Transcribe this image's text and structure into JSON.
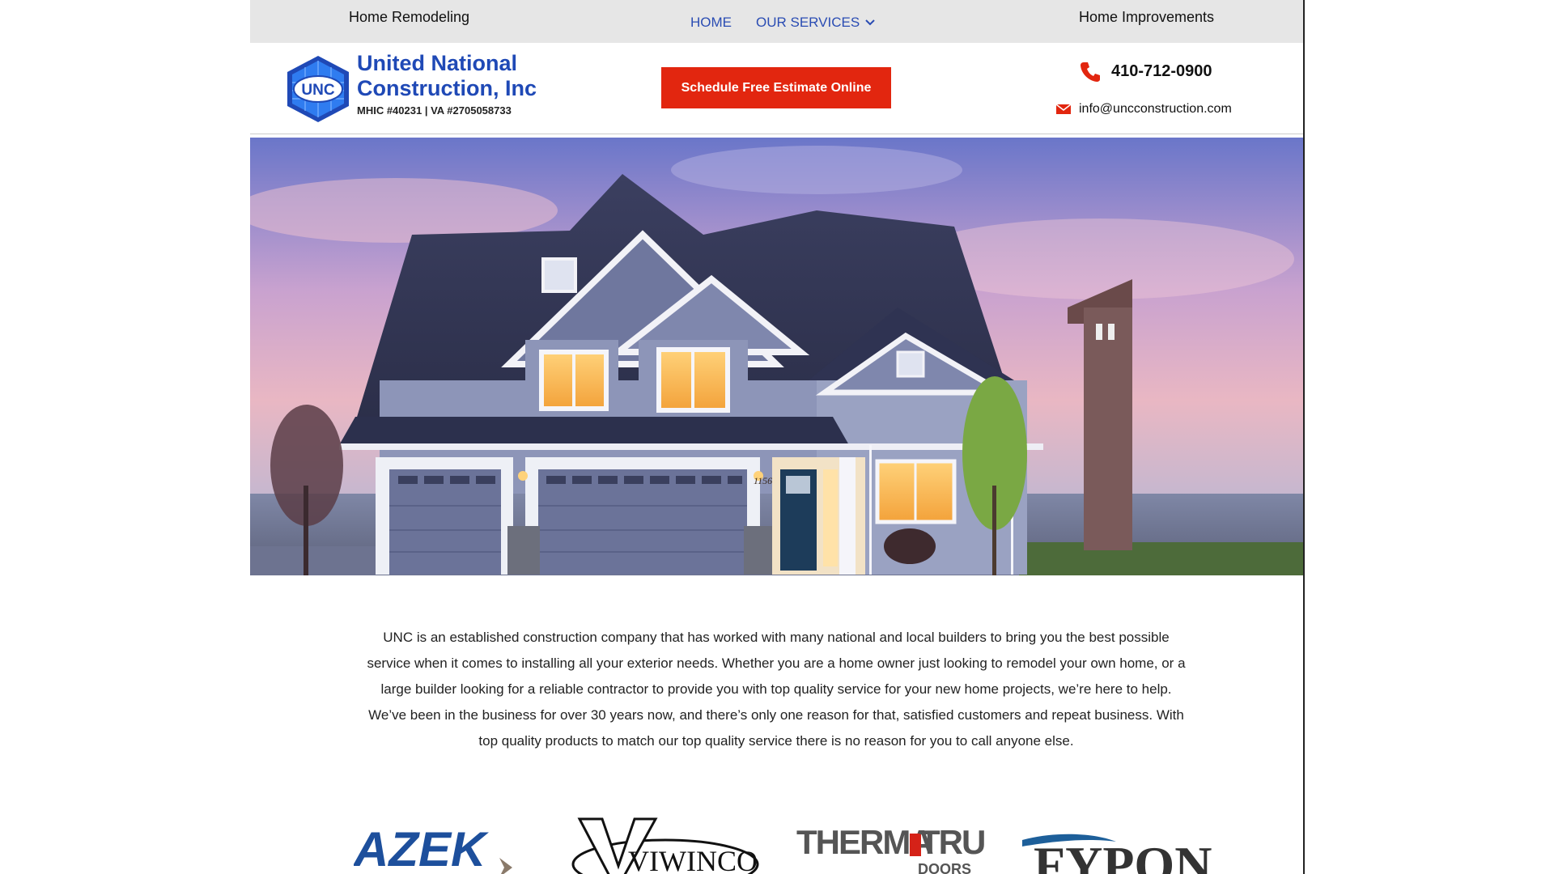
{
  "topbar": {
    "left_text": "Home Remodeling",
    "right_text": "Home Improvements",
    "nav": {
      "home": "HOME",
      "services": "OUR SERVICES"
    }
  },
  "header": {
    "logo_text": "UNC",
    "company_line1": "United National",
    "company_line2": "Construction, Inc",
    "license": "MHIC #40231 | VA #2705058733",
    "cta_label": "Schedule Free Estimate Online",
    "phone": "410-712-0900",
    "email": "info@uncconstruction.com"
  },
  "hero": {
    "house_number": "1156"
  },
  "intro": {
    "text": "UNC is an established construction company that has worked with many national and local builders to bring you the best possible service when it comes to installing all your exterior needs. Whether you are a home owner just looking to remodel your own home, or a large builder looking for a reliable contractor to provide you with top quality service for your new home projects, we’re here to help. We’ve been in the business for over 30 years now, and there’s only one reason for that, satisfied customers and repeat business. With top quality products to match our top quality service there is no reason for you to call anyone else."
  },
  "brands": {
    "azek": "AZEK",
    "viwinco": "VIWINCO",
    "thermatru_a": "THERMA",
    "thermatru_b": "TRU",
    "thermatru_c": "DOORS",
    "fypon": "FYPON"
  },
  "colors": {
    "accent_blue": "#1f49b6",
    "nav_blue": "#2a4cb3",
    "cta_red": "#e2260f",
    "topbar_bg": "#e6e6e6"
  },
  "icons": {
    "phone": "phone-icon",
    "email": "envelope-icon",
    "dropdown": "chevron-down-icon",
    "logo": "cube-logo-icon"
  }
}
